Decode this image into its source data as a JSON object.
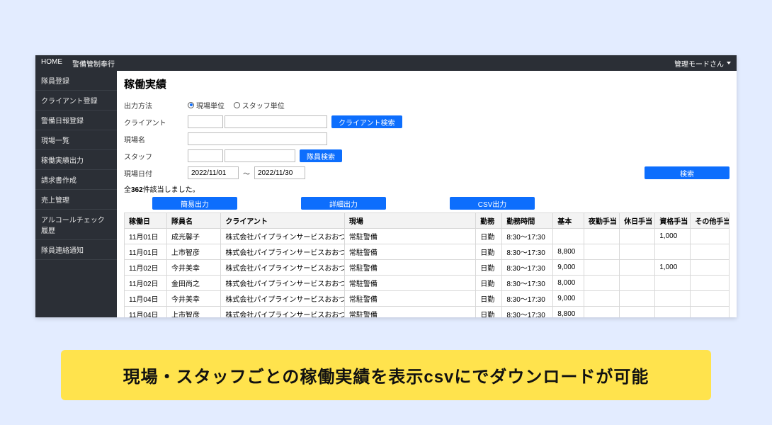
{
  "topbar": {
    "home": "HOME",
    "brand": "警備管制奉行",
    "user": "管理モードさん"
  },
  "sidebar": {
    "items": [
      "隊員登録",
      "クライアント登録",
      "警備日報登録",
      "現場一覧",
      "稼働実績出力",
      "請求書作成",
      "売上管理",
      "アルコールチェック履歴",
      "隊員連絡通知"
    ]
  },
  "page": {
    "title": "稼働実績"
  },
  "filters": {
    "output_label": "出力方法",
    "radio_site": "現場単位",
    "radio_staff": "スタッフ単位",
    "client_label": "クライアント",
    "client_search_btn": "クライアント検索",
    "site_label": "現場名",
    "staff_label": "スタッフ",
    "staff_search_btn": "隊員検索",
    "date_label": "現場日付",
    "date_from": "2022/11/01",
    "date_sep": "～",
    "date_to": "2022/11/30",
    "search_btn": "検索"
  },
  "result": {
    "prefix": "全",
    "count": "362",
    "suffix": "件該当しました。"
  },
  "actions": {
    "simple": "簡易出力",
    "detail": "詳細出力",
    "csv": "CSV出力"
  },
  "table": {
    "headers": [
      "稼働日",
      "隊員名",
      "クライアント",
      "現場",
      "勤務",
      "勤務時間",
      "基本",
      "夜勤手当",
      "休日手当",
      "資格手当",
      "その他手当"
    ],
    "rows": [
      {
        "date": "11月01日",
        "name": "成光馨子",
        "client": "株式会社パイプラインサービスおおつ",
        "site": "常駐警備",
        "shift": "日勤",
        "hours": "8:30～17:30",
        "base": "",
        "night": "",
        "holiday": "",
        "cert": "1,000",
        "other": ""
      },
      {
        "date": "11月01日",
        "name": "上市智彦",
        "client": "株式会社パイプラインサービスおおつ",
        "site": "常駐警備",
        "shift": "日勤",
        "hours": "8:30～17:30",
        "base": "8,800",
        "night": "",
        "holiday": "",
        "cert": "",
        "other": ""
      },
      {
        "date": "11月02日",
        "name": "今井美幸",
        "client": "株式会社パイプラインサービスおおつ",
        "site": "常駐警備",
        "shift": "日勤",
        "hours": "8:30～17:30",
        "base": "9,000",
        "night": "",
        "holiday": "",
        "cert": "1,000",
        "other": ""
      },
      {
        "date": "11月02日",
        "name": "金田尚之",
        "client": "株式会社パイプラインサービスおおつ",
        "site": "常駐警備",
        "shift": "日勤",
        "hours": "8:30～17:30",
        "base": "8,000",
        "night": "",
        "holiday": "",
        "cert": "",
        "other": ""
      },
      {
        "date": "11月04日",
        "name": "今井美幸",
        "client": "株式会社パイプラインサービスおおつ",
        "site": "常駐警備",
        "shift": "日勤",
        "hours": "8:30～17:30",
        "base": "9,000",
        "night": "",
        "holiday": "",
        "cert": "",
        "other": ""
      },
      {
        "date": "11月04日",
        "name": "上市智彦",
        "client": "株式会社パイプラインサービスおおつ",
        "site": "常駐警備",
        "shift": "日勤",
        "hours": "8:30～17:30",
        "base": "8,800",
        "night": "",
        "holiday": "",
        "cert": "",
        "other": ""
      }
    ]
  },
  "caption": "現場・スタッフごとの稼働実績を表示csvにでダウンロードが可能"
}
